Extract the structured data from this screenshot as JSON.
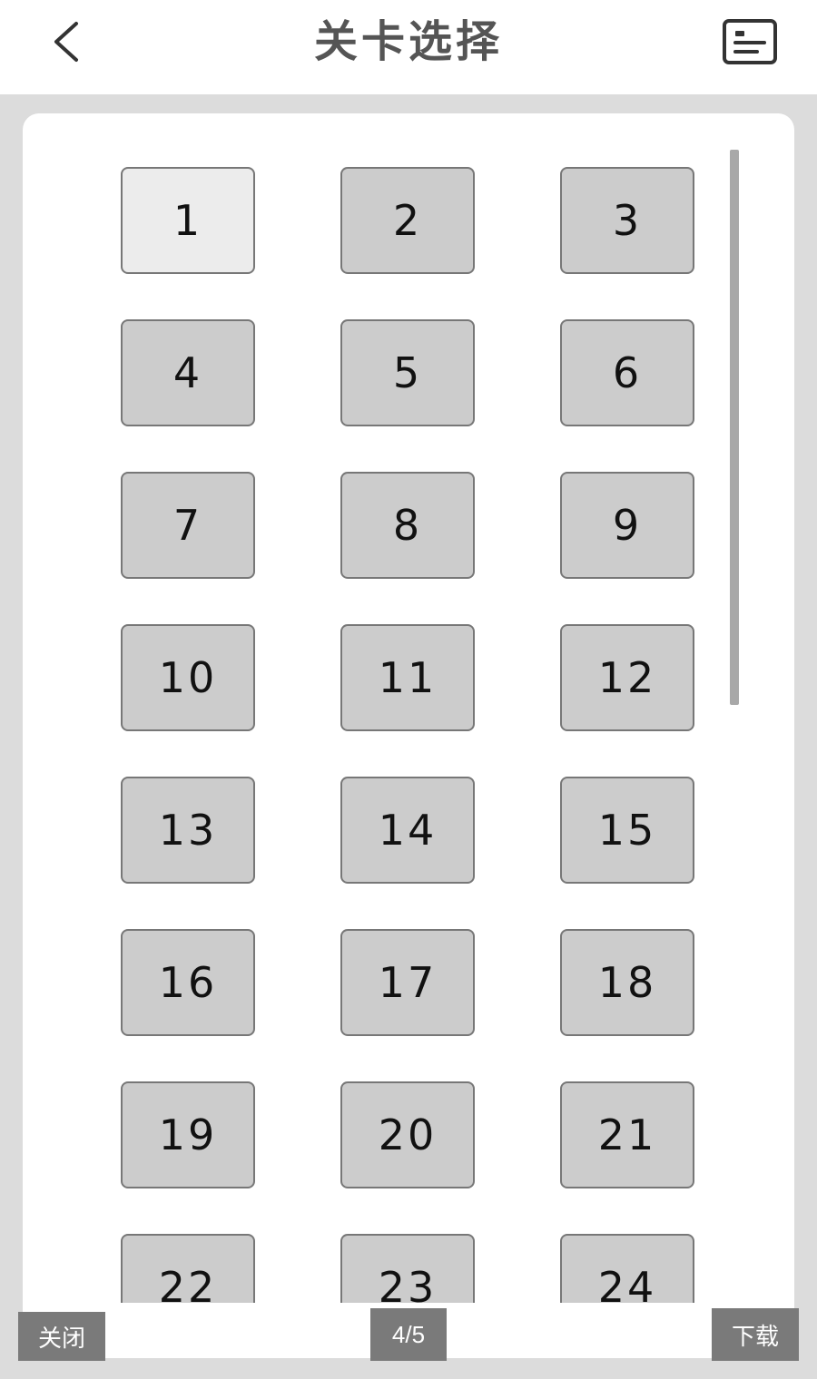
{
  "header": {
    "title": "关卡选择",
    "back_icon": "chevron-left-icon",
    "menu_icon": "list-card-icon"
  },
  "levels": [
    "1",
    "2",
    "3",
    "4",
    "5",
    "6",
    "7",
    "8",
    "9",
    "10",
    "11",
    "12",
    "13",
    "14",
    "15",
    "16",
    "17",
    "18",
    "19",
    "20",
    "21",
    "22",
    "23",
    "24"
  ],
  "selected_level": "1",
  "footer": {
    "close_label": "关闭",
    "page_indicator": "4/5",
    "download_label": "下载"
  },
  "colors": {
    "tile_bg": "#cccccc",
    "tile_active_bg": "#ececec",
    "button_bg": "#7a7a7a",
    "title_color": "#555555"
  }
}
